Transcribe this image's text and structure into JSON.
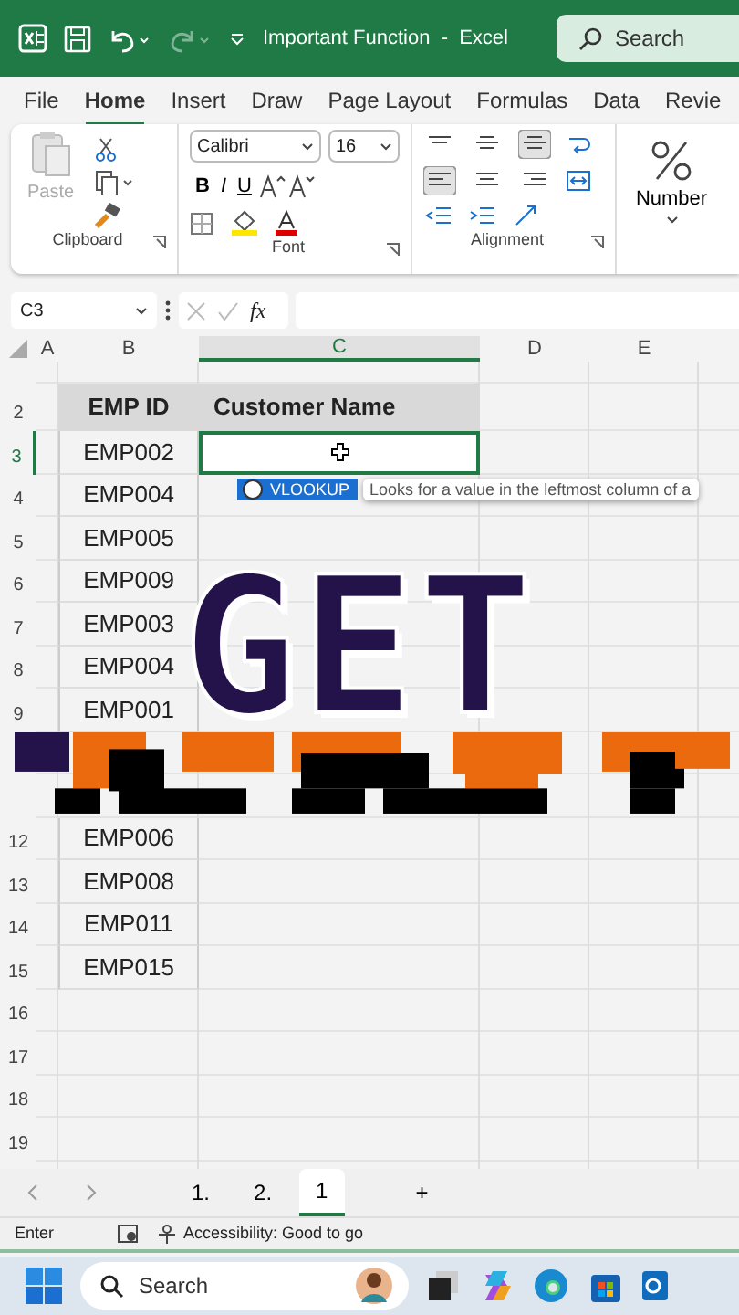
{
  "title_bar": {
    "document_title": "Important Function",
    "separator": "-",
    "app": "Excel",
    "search_placeholder": "Search"
  },
  "ribbon_tabs": [
    {
      "label": "File",
      "selected": false
    },
    {
      "label": "Home",
      "selected": true
    },
    {
      "label": "Insert",
      "selected": false
    },
    {
      "label": "Draw",
      "selected": false
    },
    {
      "label": "Page Layout",
      "selected": false
    },
    {
      "label": "Formulas",
      "selected": false
    },
    {
      "label": "Data",
      "selected": false
    },
    {
      "label": "Revie",
      "selected": false
    }
  ],
  "ribbon": {
    "paste": {
      "label": "Paste",
      "disabled": true
    },
    "clipboard_group": "Clipboard",
    "font_name": "Calibri",
    "font_size": "16",
    "bold": "B",
    "italic": "I",
    "underline": "U",
    "font_group": "Font",
    "alignment_group": "Alignment",
    "number_label": "Number"
  },
  "formula_bar": {
    "name_box": "C3",
    "fx": "fx"
  },
  "columns": [
    {
      "label": "A",
      "selected": false
    },
    {
      "label": "B",
      "selected": false
    },
    {
      "label": "C",
      "selected": true
    },
    {
      "label": "D",
      "selected": false
    },
    {
      "label": "E",
      "selected": false
    }
  ],
  "rows": [
    {
      "kind": "partial"
    },
    {
      "number": "2",
      "emp_id": "EMP ID",
      "customer": "Customer Name",
      "kind": "header"
    },
    {
      "number": "3",
      "emp_id": "EMP002",
      "kind": "data",
      "selected": true
    },
    {
      "number": "4",
      "emp_id": "EMP004",
      "kind": "data",
      "selected": false
    },
    {
      "number": "5",
      "emp_id": "EMP005",
      "kind": "data",
      "selected": false
    },
    {
      "number": "6",
      "emp_id": "EMP009",
      "kind": "data",
      "selected": false
    },
    {
      "number": "7",
      "emp_id": "EMP003",
      "kind": "data",
      "selected": false
    },
    {
      "number": "8",
      "emp_id": "EMP004",
      "kind": "data",
      "selected": false
    },
    {
      "number": "9",
      "emp_id": "EMP001",
      "kind": "data",
      "selected": false
    },
    {
      "kind": "covered"
    },
    {
      "kind": "covered"
    },
    {
      "number": "12",
      "emp_id": "EMP006",
      "kind": "data",
      "selected": false
    },
    {
      "number": "13",
      "emp_id": "EMP008",
      "kind": "data",
      "selected": false
    },
    {
      "number": "14",
      "emp_id": "EMP011",
      "kind": "data",
      "selected": false
    },
    {
      "number": "15",
      "emp_id": "EMP015",
      "kind": "data",
      "selected": false
    },
    {
      "number": "16"
    },
    {
      "number": "17"
    },
    {
      "number": "18"
    },
    {
      "number": "19"
    }
  ],
  "autocomplete": {
    "function": "VLOOKUP",
    "description": "Looks for a value in the leftmost column of a"
  },
  "overlay": {
    "headline": "GET"
  },
  "sheet_tabs": [
    {
      "label": "1.",
      "selected": false
    },
    {
      "label": "2.",
      "selected": false
    },
    {
      "label": "1",
      "selected": true
    }
  ],
  "add_sheet": "+",
  "status_bar": {
    "mode": "Enter",
    "accessibility": "Accessibility: Good to go"
  },
  "taskbar": {
    "search_placeholder": "Search"
  }
}
